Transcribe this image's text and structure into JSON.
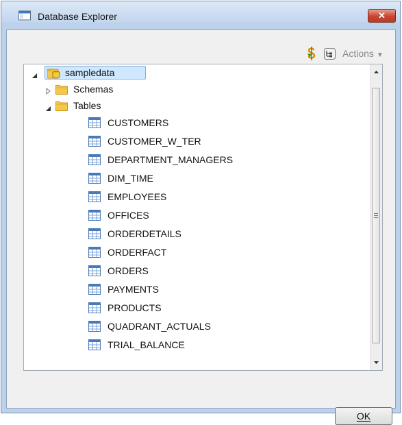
{
  "window": {
    "title": "Database Explorer"
  },
  "toolbar": {
    "actions_label": "Actions"
  },
  "tree": {
    "root": {
      "label": "sampledata",
      "expanded": true,
      "selected": true
    },
    "schemas": {
      "label": "Schemas",
      "expanded": false
    },
    "tables": {
      "label": "Tables",
      "expanded": true,
      "items": [
        "CUSTOMERS",
        "CUSTOMER_W_TER",
        "DEPARTMENT_MANAGERS",
        "DIM_TIME",
        "EMPLOYEES",
        "OFFICES",
        "ORDERDETAILS",
        "ORDERFACT",
        "ORDERS",
        "PAYMENTS",
        "PRODUCTS",
        "QUADRANT_ACTUALS",
        "TRIAL_BALANCE"
      ]
    }
  },
  "footer": {
    "ok_label": "OK"
  },
  "colors": {
    "close_button": "#c8452e",
    "selection": "#cde8ff",
    "folder": "#f5c84c"
  }
}
